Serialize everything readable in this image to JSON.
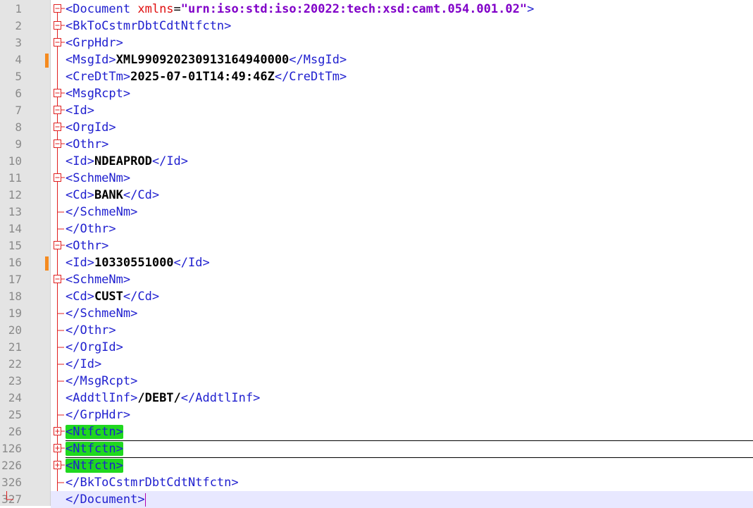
{
  "editor": {
    "lines": [
      {
        "n": "1",
        "fold": "minus",
        "segs": [
          {
            "t": "<Document ",
            "c": "t"
          },
          {
            "t": "xmlns",
            "c": "an"
          },
          {
            "t": "=",
            "c": "eq"
          },
          {
            "t": "\"urn:iso:std:iso:20022:tech:xsd:camt.054.001.02\"",
            "c": "av"
          },
          {
            "t": ">",
            "c": "t"
          }
        ]
      },
      {
        "n": "2",
        "fold": "minus",
        "segs": [
          {
            "t": "<BkToCstmrDbtCdtNtfctn>",
            "c": "t"
          }
        ]
      },
      {
        "n": "3",
        "fold": "minus",
        "segs": [
          {
            "t": "<GrpHdr>",
            "c": "t"
          }
        ]
      },
      {
        "n": "4",
        "fold": "line",
        "mark": "#f58a1f",
        "segs": [
          {
            "t": "<MsgId>",
            "c": "t"
          },
          {
            "t": "XML990920230913164940000",
            "c": "v"
          },
          {
            "t": "</MsgId>",
            "c": "t"
          }
        ]
      },
      {
        "n": "5",
        "fold": "line",
        "segs": [
          {
            "t": "<CreDtTm>",
            "c": "t"
          },
          {
            "t": "2025-07-01T14:49:46Z",
            "c": "v"
          },
          {
            "t": "</CreDtTm>",
            "c": "t"
          }
        ]
      },
      {
        "n": "6",
        "fold": "minus",
        "segs": [
          {
            "t": "<MsgRcpt>",
            "c": "t"
          }
        ]
      },
      {
        "n": "7",
        "fold": "minus",
        "segs": [
          {
            "t": "<Id>",
            "c": "t"
          }
        ]
      },
      {
        "n": "8",
        "fold": "minus",
        "segs": [
          {
            "t": "<OrgId>",
            "c": "t"
          }
        ]
      },
      {
        "n": "9",
        "fold": "minus",
        "segs": [
          {
            "t": "<Othr>",
            "c": "t"
          }
        ]
      },
      {
        "n": "10",
        "fold": "line",
        "segs": [
          {
            "t": "<Id>",
            "c": "t"
          },
          {
            "t": "NDEAPROD",
            "c": "v"
          },
          {
            "t": "</Id>",
            "c": "t"
          }
        ]
      },
      {
        "n": "11",
        "fold": "minus",
        "segs": [
          {
            "t": "<SchmeNm>",
            "c": "t"
          }
        ]
      },
      {
        "n": "12",
        "fold": "line",
        "segs": [
          {
            "t": "<Cd>",
            "c": "t"
          },
          {
            "t": "BANK",
            "c": "v"
          },
          {
            "t": "</Cd>",
            "c": "t"
          }
        ]
      },
      {
        "n": "13",
        "fold": "end",
        "segs": [
          {
            "t": "</SchmeNm>",
            "c": "t"
          }
        ]
      },
      {
        "n": "14",
        "fold": "end",
        "segs": [
          {
            "t": "</Othr>",
            "c": "t"
          }
        ]
      },
      {
        "n": "15",
        "fold": "minus",
        "segs": [
          {
            "t": "<Othr>",
            "c": "t"
          }
        ]
      },
      {
        "n": "16",
        "fold": "line",
        "mark": "#f58a1f",
        "segs": [
          {
            "t": "<Id>",
            "c": "t"
          },
          {
            "t": "10330551000",
            "c": "v"
          },
          {
            "t": "</Id>",
            "c": "t"
          }
        ]
      },
      {
        "n": "17",
        "fold": "minus",
        "segs": [
          {
            "t": "<SchmeNm>",
            "c": "t"
          }
        ]
      },
      {
        "n": "18",
        "fold": "line",
        "segs": [
          {
            "t": "<Cd>",
            "c": "t"
          },
          {
            "t": "CUST",
            "c": "v"
          },
          {
            "t": "</Cd>",
            "c": "t"
          }
        ]
      },
      {
        "n": "19",
        "fold": "end",
        "segs": [
          {
            "t": "</SchmeNm>",
            "c": "t"
          }
        ]
      },
      {
        "n": "20",
        "fold": "end",
        "segs": [
          {
            "t": "</Othr>",
            "c": "t"
          }
        ]
      },
      {
        "n": "21",
        "fold": "end",
        "segs": [
          {
            "t": "</OrgId>",
            "c": "t"
          }
        ]
      },
      {
        "n": "22",
        "fold": "end",
        "segs": [
          {
            "t": "</Id>",
            "c": "t"
          }
        ]
      },
      {
        "n": "23",
        "fold": "end",
        "segs": [
          {
            "t": "</MsgRcpt>",
            "c": "t"
          }
        ]
      },
      {
        "n": "24",
        "fold": "line",
        "segs": [
          {
            "t": "<AddtlInf>",
            "c": "t"
          },
          {
            "t": "/DEBT/",
            "c": "v"
          },
          {
            "t": "</AddtlInf>",
            "c": "t"
          }
        ]
      },
      {
        "n": "25",
        "fold": "end",
        "segs": [
          {
            "t": "</GrpHdr>",
            "c": "t"
          }
        ]
      },
      {
        "n": "26",
        "fold": "plus",
        "collapsed": true,
        "segs": [
          {
            "t": "<Ntfctn>",
            "c": "hl"
          }
        ]
      },
      {
        "n": "126",
        "fold": "plus",
        "collapsed": true,
        "segs": [
          {
            "t": "<Ntfctn>",
            "c": "hl"
          }
        ]
      },
      {
        "n": "226",
        "fold": "plus",
        "segs": [
          {
            "t": "<Ntfctn>",
            "c": "hl"
          }
        ]
      },
      {
        "n": "326",
        "fold": "end",
        "segs": [
          {
            "t": "</BkToCstmrDbtCdtNtfctn>",
            "c": "t"
          }
        ]
      },
      {
        "n": "327",
        "fold": "last",
        "caret": true,
        "segs": [
          {
            "t": "</Document>",
            "c": "t"
          }
        ]
      }
    ],
    "colors": {
      "gutter": "#e4e4e4",
      "tag": "#1f1fcf",
      "attr_name": "#e01010",
      "attr_value": "#8000c8",
      "fold_tree": "#e02020",
      "highlight": "#1fd81f",
      "change_mark": "#f58a1f",
      "caret_line": "#e8e8ff"
    }
  }
}
